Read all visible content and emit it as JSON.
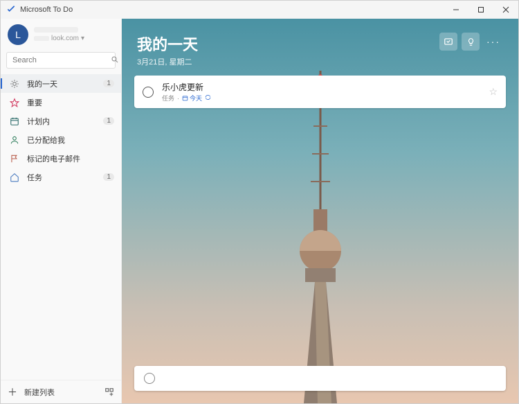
{
  "titlebar": {
    "app_name": "Microsoft To Do"
  },
  "account": {
    "initial": "L",
    "email_suffix": "look.com",
    "chevron": "▾"
  },
  "search": {
    "placeholder": "Search"
  },
  "nav": {
    "items": [
      {
        "key": "myday",
        "label": "我的一天",
        "count": "1",
        "icon": "sun",
        "color": "#777"
      },
      {
        "key": "important",
        "label": "重要",
        "count": "",
        "icon": "star",
        "color": "#d23b61"
      },
      {
        "key": "planned",
        "label": "计划内",
        "count": "1",
        "icon": "calendar",
        "color": "#2b6b69"
      },
      {
        "key": "assigned",
        "label": "已分配给我",
        "count": "",
        "icon": "person",
        "color": "#2e7d5b"
      },
      {
        "key": "flagged",
        "label": "标记的电子邮件",
        "count": "",
        "icon": "flag",
        "color": "#b85c4b"
      },
      {
        "key": "tasks",
        "label": "任务",
        "count": "1",
        "icon": "home",
        "color": "#4b7bbf"
      }
    ]
  },
  "bottombar": {
    "new_list": "新建列表"
  },
  "header": {
    "title": "我的一天",
    "date": "3月21日, 星期二"
  },
  "tasks": [
    {
      "title": "乐小虎更新",
      "source": "任务",
      "due_label": "今天"
    }
  ],
  "addtask": {
    "placeholder": " "
  }
}
